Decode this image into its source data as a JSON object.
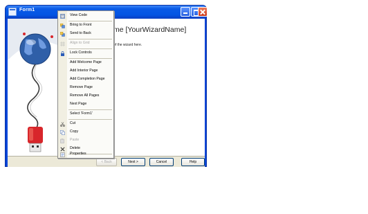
{
  "window": {
    "title": "Form1",
    "title_icon": "form-icon",
    "controls": [
      "minimize-icon",
      "maximize-icon",
      "close-icon"
    ]
  },
  "wizard": {
    "heading": "me [YourWizardName]",
    "intro": "of the wizard here.",
    "buttons": {
      "back": "< Back",
      "next": "Next >",
      "cancel": "Cancel",
      "help": "Help"
    }
  },
  "context_menu": {
    "items": [
      {
        "label": "View Code",
        "icon": "view-code-icon",
        "enabled": true
      },
      {
        "label": "Bring to Front",
        "icon": "bring-to-front-icon",
        "enabled": true
      },
      {
        "label": "Send to Back",
        "icon": "send-to-back-icon",
        "enabled": true
      },
      {
        "label": "Align to Grid",
        "icon": "align-to-grid-icon",
        "enabled": false
      },
      {
        "label": "Lock Controls",
        "icon": "lock-icon",
        "enabled": true
      },
      {
        "label": "Add Welcome Page",
        "icon": "",
        "enabled": true
      },
      {
        "label": "Add Interior Page",
        "icon": "",
        "enabled": true
      },
      {
        "label": "Add Completion Page",
        "icon": "",
        "enabled": true
      },
      {
        "label": "Remove Page",
        "icon": "",
        "enabled": true
      },
      {
        "label": "Remove All Pages",
        "icon": "",
        "enabled": true
      },
      {
        "label": "Next Page",
        "icon": "",
        "enabled": true
      },
      {
        "label": "Select 'Form1'",
        "icon": "",
        "enabled": true
      },
      {
        "label": "Cut",
        "icon": "scissors-icon",
        "enabled": true
      },
      {
        "label": "Copy",
        "icon": "copy-icon",
        "enabled": true
      },
      {
        "label": "Paste",
        "icon": "paste-icon",
        "enabled": false
      },
      {
        "label": "Delete",
        "icon": "delete-icon",
        "enabled": true
      },
      {
        "label": "Properties",
        "icon": "properties-icon",
        "enabled": true
      }
    ]
  },
  "colors": {
    "titlebar": "#0455e4",
    "menu_gutter": "#f1efe2",
    "usb_red": "#d8262b",
    "globe_blue": "#2f5fa8"
  }
}
